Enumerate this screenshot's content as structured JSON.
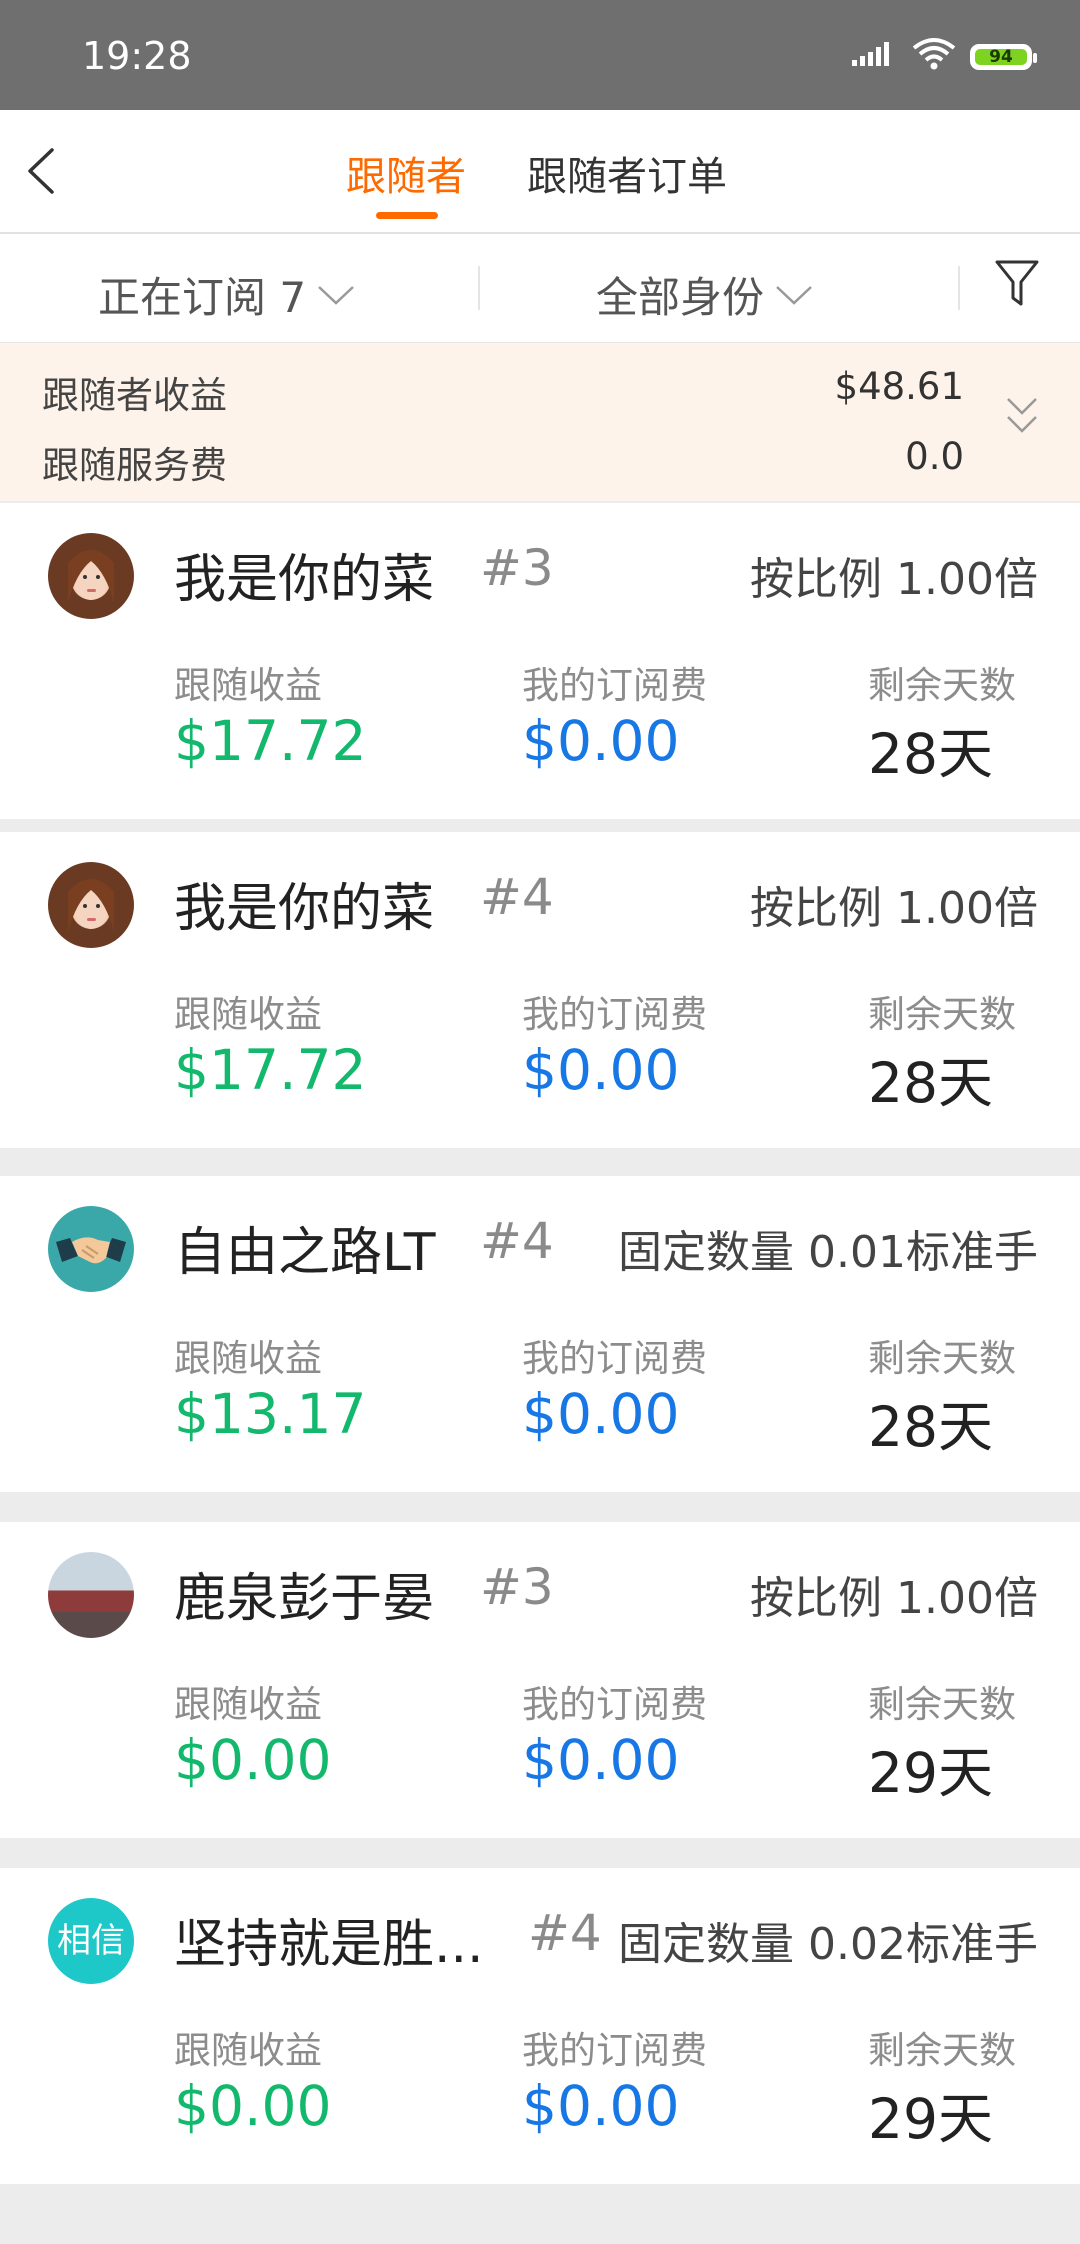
{
  "status": {
    "time": "19:28",
    "battery": "94"
  },
  "nav": {
    "tabs": [
      {
        "label": "跟随者"
      },
      {
        "label": "跟随者订单"
      }
    ]
  },
  "filters": {
    "subscribing": "正在订阅 7",
    "identity": "全部身份"
  },
  "summary": {
    "follower_income_label": "跟随者收益",
    "follower_income_value": "$48.61",
    "service_fee_label": "跟随服务费",
    "service_fee_value": "0.0"
  },
  "columns": {
    "income": "跟随收益",
    "fee": "我的订阅费",
    "days": "剩余天数"
  },
  "followers": [
    {
      "name": "我是你的菜",
      "rank": "#3",
      "mode": "按比例 1.00倍",
      "income": "$17.72",
      "fee": "$0.00",
      "days": "28天",
      "avatar": "photo-woman"
    },
    {
      "name": "我是你的菜",
      "rank": "#4",
      "mode": "按比例 1.00倍",
      "income": "$17.72",
      "fee": "$0.00",
      "days": "28天",
      "avatar": "photo-woman"
    },
    {
      "name": "自由之路LT",
      "rank": "#4",
      "mode": "固定数量 0.01标准手",
      "income": "$13.17",
      "fee": "$0.00",
      "days": "28天",
      "avatar": "handshake"
    },
    {
      "name": "鹿泉彭于晏",
      "rank": "#3",
      "mode": "按比例 1.00倍",
      "income": "$0.00",
      "fee": "$0.00",
      "days": "29天",
      "avatar": "photo-scene"
    },
    {
      "name": "坚持就是胜...",
      "rank": "#4",
      "mode": "固定数量 0.02标准手",
      "income": "$0.00",
      "fee": "$0.00",
      "days": "29天",
      "avatar": "text-avatar",
      "avatar_text": "相信"
    }
  ],
  "colors": {
    "accent": "#ff6a00",
    "income": "#12b86b",
    "fee": "#1677e5",
    "summary_bg": "#fdf3ea"
  }
}
